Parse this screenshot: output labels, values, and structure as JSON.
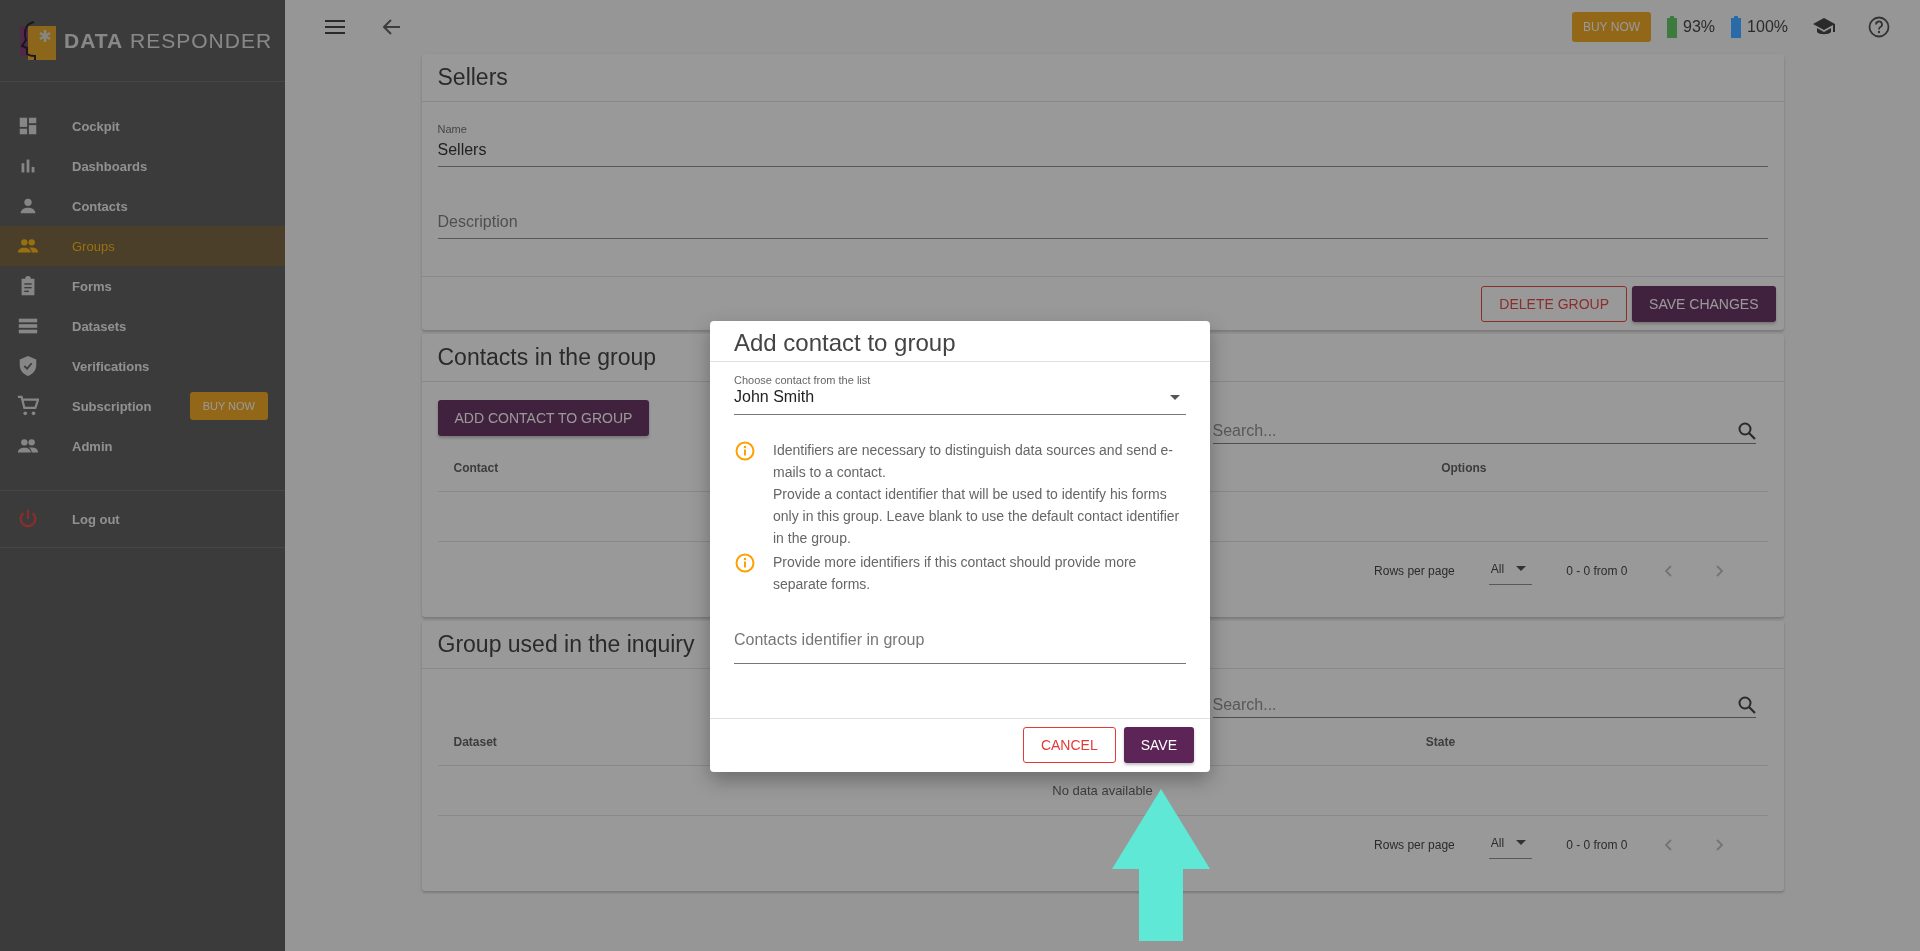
{
  "sidebar": {
    "logo": {
      "bold": "DATA",
      "light": "RESPONDER"
    },
    "items": [
      {
        "label": "Cockpit",
        "selected": false
      },
      {
        "label": "Dashboards",
        "selected": false
      },
      {
        "label": "Contacts",
        "selected": false
      },
      {
        "label": "Groups",
        "selected": true
      },
      {
        "label": "Forms",
        "selected": false
      },
      {
        "label": "Datasets",
        "selected": false
      },
      {
        "label": "Verifications",
        "selected": false
      },
      {
        "label": "Subscription",
        "selected": false,
        "badge": "BUY NOW"
      },
      {
        "label": "Admin",
        "selected": false
      }
    ],
    "logout": {
      "label": "Log out"
    }
  },
  "top_bar": {
    "buy_now": "BUY NOW",
    "batteries": [
      {
        "reading": "93%",
        "color": "#3d7a3d"
      },
      {
        "reading": "100%",
        "color": "#2a6aa8"
      }
    ]
  },
  "group_card": {
    "title": "Sellers",
    "name_field": {
      "label": "Name",
      "value": "Sellers"
    },
    "description_field": {
      "placeholder": "Description"
    },
    "delete_button": "DELETE GROUP",
    "save_button": "SAVE CHANGES"
  },
  "contacts_card": {
    "title": "Contacts in the group",
    "add_button": "ADD CONTACT TO GROUP",
    "search": {
      "placeholder": "Search..."
    },
    "columns": [
      "Contact",
      "Options"
    ],
    "footer": {
      "rows_per_page_label": "Rows per page",
      "rows_per_page_value": "All",
      "range": "0 - 0 from 0"
    }
  },
  "inquiry_card": {
    "title": "Group used in the inquiry",
    "search": {
      "placeholder": "Search..."
    },
    "columns": [
      "Dataset",
      "State"
    ],
    "empty_text": "No data available",
    "footer": {
      "rows_per_page_label": "Rows per page",
      "rows_per_page_value": "All",
      "range": "0 - 0 from 0"
    }
  },
  "dialog": {
    "title": "Add contact to group",
    "select": {
      "label": "Choose contact from the list",
      "value": "John Smith"
    },
    "notes": [
      {
        "paragraphs": [
          "Identifiers are necessary to distinguish data sources and send e-mails to a contact.",
          "Provide a contact identifier that will be used to identify his forms only in this group. Leave blank to use the default contact identifier in the group."
        ]
      },
      {
        "paragraphs": [
          "Provide more identifiers if this contact should provide more separate forms."
        ]
      }
    ],
    "identifier_field": {
      "placeholder": "Contacts identifier in group"
    },
    "cancel_button": "CANCEL",
    "save_button": "SAVE"
  }
}
